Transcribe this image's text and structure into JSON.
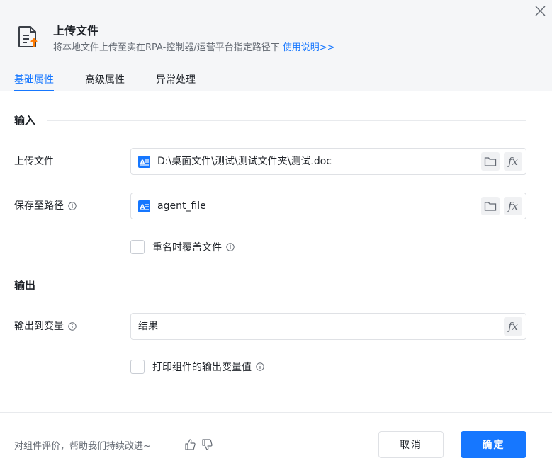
{
  "header": {
    "title": "上传文件",
    "subtitle": "将本地文件上传至实在RPA-控制器/运营平台指定路径下",
    "help_link": "使用说明>>"
  },
  "tabs": [
    {
      "label": "基础属性",
      "active": true
    },
    {
      "label": "高级属性",
      "active": false
    },
    {
      "label": "异常处理",
      "active": false
    }
  ],
  "sections": {
    "input_title": "输入",
    "output_title": "输出"
  },
  "fields": {
    "upload_file": {
      "label": "上传文件",
      "value": "D:\\桌面文件\\测试\\测试文件夹\\测试.doc"
    },
    "save_path": {
      "label": "保存至路径",
      "value": "agent_file"
    },
    "overwrite": {
      "label": "重名时覆盖文件",
      "checked": false
    },
    "output_var": {
      "label": "输出到变量",
      "value": "结果"
    },
    "print_output": {
      "label": "打印组件的输出变量值",
      "checked": false
    }
  },
  "footer": {
    "feedback": "对组件评价，帮助我们持续改进~",
    "cancel_label": "取消",
    "ok_label": "确定"
  },
  "colors": {
    "accent": "#1677ff",
    "header_bg": "#f5f6f8"
  }
}
